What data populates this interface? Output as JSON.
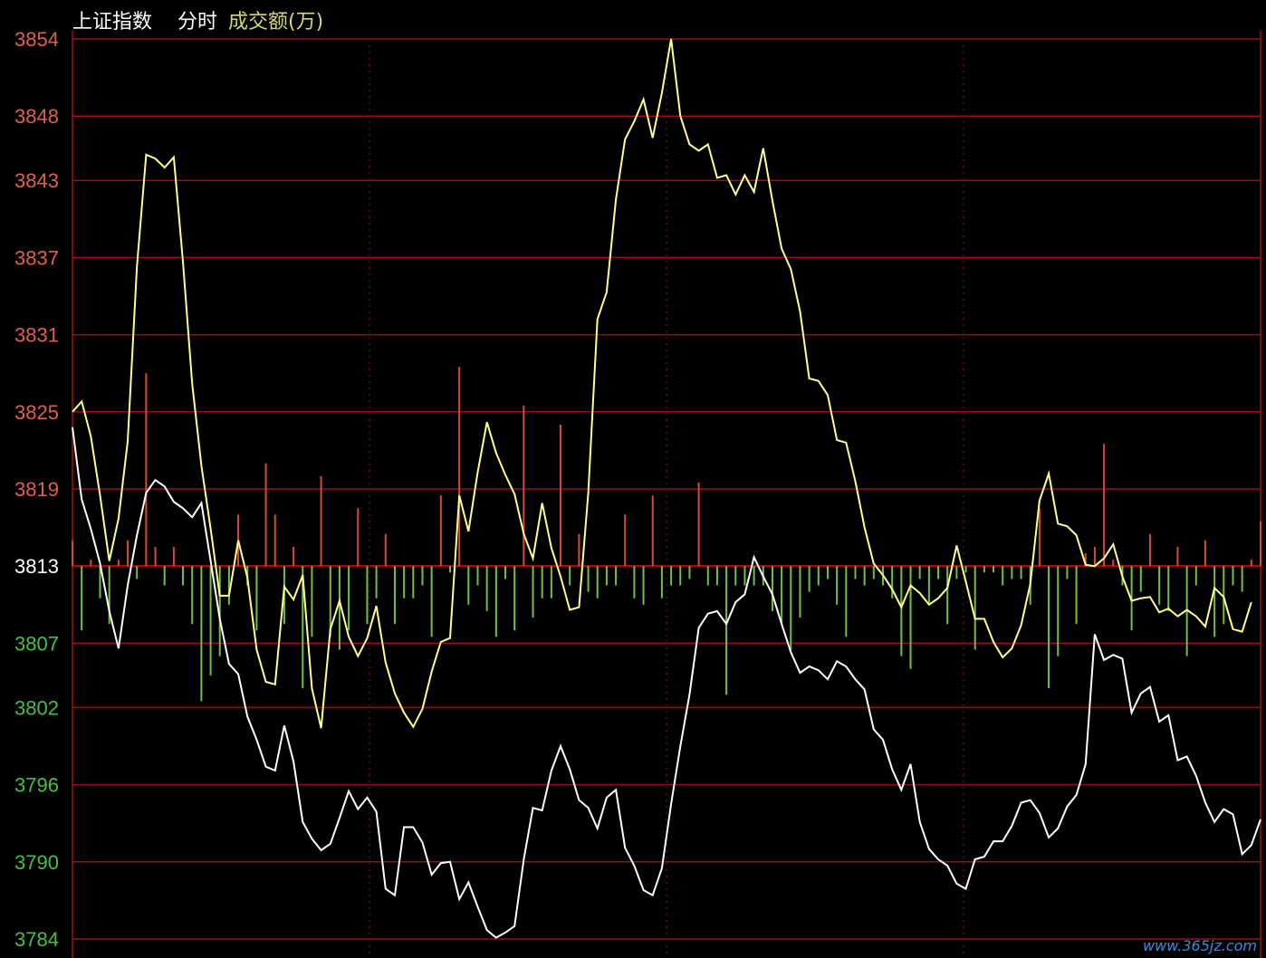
{
  "header": {
    "index_name": "上证指数",
    "mode": "分时",
    "indicator": "成交额(万)"
  },
  "watermark": "www.365jz.com",
  "colors": {
    "background": "#000000",
    "grid": "#9a1010",
    "axis_up": "#e0604a",
    "axis_base": "#ffffff",
    "axis_down": "#44c044",
    "price_line": "#ffffff",
    "avg_line": "#ffff90",
    "volume_up": "#d84a35",
    "volume_down": "#6fbf4a",
    "header_text": "#ffffff",
    "indicator_text": "#d6d67a"
  },
  "chart_data": {
    "type": "line",
    "ylim": [
      3784,
      3854
    ],
    "baseline": 3813,
    "y_ticks": [
      3854,
      3848,
      3843,
      3837,
      3831,
      3825,
      3819,
      3813,
      3807,
      3802,
      3796,
      3790,
      3784
    ],
    "grid": true,
    "series": [
      {
        "key": "price",
        "values": [
          3823.8,
          3818.2,
          3815.9,
          3813.2,
          3809.5,
          3806.6,
          3811.5,
          3815.4,
          3818.7,
          3819.7,
          3819.2,
          3818.0,
          3817.5,
          3816.8,
          3817.9,
          3813.4,
          3808.9,
          3805.4,
          3804.6,
          3801.3,
          3799.5,
          3797.4,
          3797.1,
          3800.6,
          3797.8,
          3793.1,
          3791.8,
          3790.9,
          3791.4,
          3793.4,
          3795.5,
          3794.1,
          3795.0,
          3793.9,
          3787.9,
          3787.4,
          3792.7,
          3792.7,
          3791.5,
          3789.0,
          3789.9,
          3790.0,
          3787.1,
          3788.4,
          3786.5,
          3784.7,
          3784.1,
          3784.5,
          3785.0,
          3790.2,
          3794.2,
          3794.0,
          3797.1,
          3799.0,
          3797.2,
          3794.8,
          3794.2,
          3792.6,
          3795.0,
          3795.6,
          3791.1,
          3789.7,
          3787.8,
          3787.4,
          3789.5,
          3794.5,
          3799.0,
          3803.0,
          3808.2,
          3809.3,
          3809.5,
          3808.5,
          3810.2,
          3810.8,
          3813.7,
          3812.2,
          3810.8,
          3808.5,
          3806.3,
          3804.7,
          3805.2,
          3804.9,
          3804.2,
          3805.6,
          3805.2,
          3804.2,
          3803.4,
          3800.3,
          3799.5,
          3797.2,
          3795.6,
          3797.6,
          3793.1,
          3791.0,
          3790.2,
          3789.7,
          3788.3,
          3787.9,
          3790.2,
          3790.4,
          3791.6,
          3791.6,
          3792.8,
          3794.6,
          3794.8,
          3793.8,
          3791.9,
          3792.6,
          3794.3,
          3795.2,
          3797.6,
          3807.7,
          3805.7,
          3806.1,
          3805.8,
          3801.6,
          3803.1,
          3803.6,
          3800.9,
          3801.4,
          3797.9,
          3798.2,
          3796.7,
          3794.6,
          3793.1,
          3794.1,
          3793.7,
          3790.6,
          3791.3,
          3793.3
        ],
        "color": "#ffffff"
      },
      {
        "key": "average",
        "values": [
          3825.0,
          3825.8,
          3823.1,
          3818.5,
          3813.4,
          3816.7,
          3822.7,
          3836.3,
          3845.0,
          3844.7,
          3844.0,
          3844.8,
          3836.7,
          3827.2,
          3820.8,
          3815.9,
          3810.7,
          3810.7,
          3815.0,
          3812.1,
          3806.5,
          3804.0,
          3803.8,
          3811.4,
          3810.4,
          3812.3,
          3803.5,
          3800.4,
          3808.1,
          3810.3,
          3807.5,
          3806.0,
          3807.4,
          3809.9,
          3805.5,
          3803.1,
          3801.6,
          3800.5,
          3801.9,
          3804.8,
          3807.1,
          3807.4,
          3818.5,
          3815.7,
          3820.3,
          3824.2,
          3821.8,
          3820.1,
          3818.6,
          3815.5,
          3813.6,
          3817.9,
          3814.4,
          3812.2,
          3809.6,
          3809.8,
          3818.7,
          3832.2,
          3834.3,
          3841.5,
          3846.2,
          3847.6,
          3849.3,
          3846.3,
          3849.8,
          3854.0,
          3848.0,
          3845.8,
          3845.3,
          3845.8,
          3843.2,
          3843.4,
          3841.9,
          3843.4,
          3842.1,
          3845.5,
          3841.4,
          3837.7,
          3836.1,
          3832.8,
          3827.6,
          3827.4,
          3826.3,
          3822.8,
          3822.6,
          3819.6,
          3816.0,
          3813.2,
          3812.3,
          3811.2,
          3809.8,
          3811.5,
          3810.9,
          3810.0,
          3810.5,
          3811.3,
          3814.6,
          3811.8,
          3808.9,
          3808.9,
          3807.1,
          3805.9,
          3806.6,
          3808.4,
          3811.6,
          3818.1,
          3820.2,
          3816.3,
          3816.1,
          3815.4,
          3813.1,
          3813.0,
          3813.6,
          3814.7,
          3812.2,
          3810.3,
          3810.5,
          3810.6,
          3809.4,
          3809.7,
          3809.1,
          3809.6,
          3809.1,
          3808.3,
          3811.3,
          3810.6,
          3808.1,
          3807.9,
          3810.2
        ],
        "color": "#ffff90"
      },
      {
        "key": "volume",
        "values": [
          2.0,
          -5.0,
          0.5,
          -2.5,
          -4.5,
          0.5,
          2.0,
          -1.0,
          15.0,
          1.5,
          -1.5,
          1.5,
          -1.5,
          -4.5,
          -10.5,
          -8.5,
          -7.0,
          -3.0,
          4.0,
          -1.5,
          -5.0,
          8.0,
          4.0,
          -4.5,
          1.5,
          -9.5,
          -5.5,
          7.0,
          -5.5,
          -6.5,
          -5.0,
          4.5,
          -4.5,
          -2.5,
          2.5,
          -4.5,
          -2.5,
          -2.5,
          -1.5,
          -5.5,
          5.5,
          -0.5,
          15.5,
          -3.0,
          -1.5,
          -3.5,
          -5.5,
          -1.0,
          -5.0,
          12.5,
          -4.0,
          -2.5,
          -2.5,
          11.0,
          -1.5,
          2.5,
          -2.0,
          -2.5,
          -1.5,
          -1.5,
          4.0,
          -2.5,
          -3.0,
          5.5,
          -2.5,
          -1.5,
          -1.5,
          -1.0,
          6.5,
          -1.5,
          -1.5,
          -10.0,
          -1.5,
          -1.5,
          -1.5,
          -1.5,
          -3.5,
          -4.5,
          -6.5,
          -4.0,
          -2.0,
          -1.5,
          -1.0,
          -3.0,
          -5.5,
          -1.0,
          -1.5,
          -1.0,
          -1.5,
          -2.5,
          -7.0,
          -8.0,
          -1.0,
          -3.0,
          -1.0,
          -4.5,
          -1.0,
          -0.5,
          -6.5,
          -0.5,
          -0.5,
          -1.5,
          -1.0,
          -1.0,
          -3.0,
          4.5,
          -9.5,
          -7.0,
          -1.0,
          -4.5,
          1.0,
          1.5,
          9.5,
          0.5,
          -1.5,
          -5.0,
          -2.0,
          2.5,
          -3.0,
          -3.5,
          1.5,
          -7.0,
          -1.5,
          2.0,
          -5.5,
          -4.5,
          -1.5,
          -2.0,
          0.5,
          3.5,
          -9.0,
          -1.0
        ],
        "color": "#d84a35"
      }
    ]
  }
}
